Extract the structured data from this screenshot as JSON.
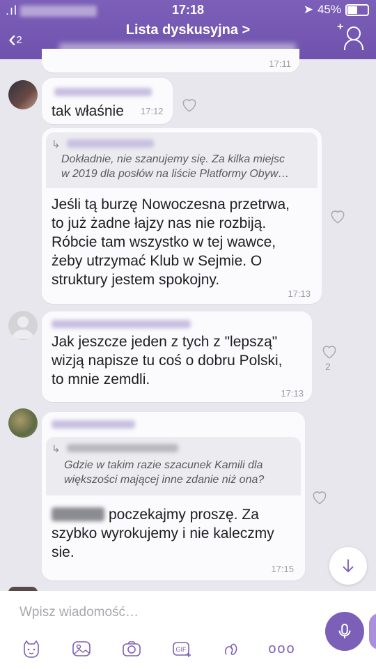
{
  "status_bar": {
    "carrier": ".ıl",
    "time": "17:18",
    "battery": "45%"
  },
  "header": {
    "back_count": "2",
    "title": "Lista dyskusyjna >"
  },
  "messages": [
    {
      "time": "17:11"
    },
    {
      "text": "tak właśnie",
      "time": "17:12"
    },
    {
      "quote": "Dokładnie, nie szanujemy się. Za kilka miejsc\nw 2019 dla posłów na liście Platformy Obyw…",
      "text": "Jeśli tą burzę Nowoczesna przetrwa,\nto już żadne łajzy nas nie rozbiją.\nRóbcie tam wszystko w tej wawce,\nżeby utrzymać Klub w Sejmie. O\nstruktury jestem spokojny.",
      "time": "17:13"
    },
    {
      "text": "Jak jeszcze jeden z tych z \"lepszą\"\nwizją napisze tu coś o dobru Polski,\nto mnie zemdli.",
      "time": "17:13",
      "likes": "2"
    },
    {
      "quote": "Gdzie w takim razie szacunek Kamili dla\nwiększości mającej inne zdanie niż ona?",
      "text": "poczekajmy proszę. Za\nszybko wyrokujemy i nie kaleczmy\nsie.",
      "time": "17:15"
    }
  ],
  "composer": {
    "placeholder": "Wpisz wiadomość…"
  },
  "toolbar": {
    "gif_label": "GIF",
    "more_label": "ooo"
  },
  "icons": [
    "back-icon",
    "add-user-icon",
    "heart-icon",
    "arrow-down-icon",
    "mic-icon",
    "sticker-icon",
    "gallery-icon",
    "camera-icon",
    "gif-icon",
    "doodle-icon",
    "more-icon"
  ],
  "colors": {
    "accent": "#7c5fb8",
    "background": "#e9e7ee",
    "bubble": "#fbfbfd"
  }
}
